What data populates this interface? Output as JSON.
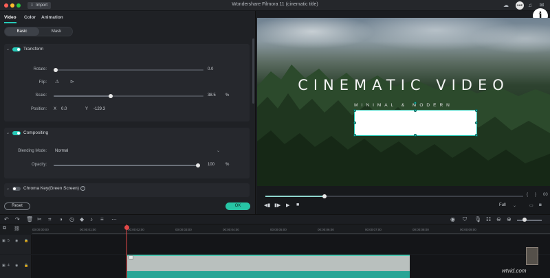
{
  "window": {
    "title": "Wondershare Filmora 11 (cinematic title)",
    "import_label": "Import",
    "avatar_text": "OUP"
  },
  "tabs": [
    {
      "label": "Video"
    },
    {
      "label": "Color"
    },
    {
      "label": "Animation"
    }
  ],
  "segments": {
    "basic": "Basic",
    "mask": "Mask"
  },
  "transform": {
    "title": "Transform",
    "rotate_label": "Rotate:",
    "rotate_value": "0.0",
    "flip_label": "Flip:",
    "scale_label": "Scale:",
    "scale_value": "38.5",
    "scale_unit": "%",
    "scale_fraction": 0.38,
    "position_label": "Position:",
    "x_label": "X",
    "x_value": "0.0",
    "y_label": "Y",
    "y_value": "-129.3"
  },
  "compositing": {
    "title": "Compositing",
    "blend_label": "Blending Mode:",
    "blend_value": "Normal",
    "opacity_label": "Opacity:",
    "opacity_value": "100",
    "opacity_unit": "%",
    "opacity_fraction": 1.0
  },
  "chroma": {
    "title": "Chroma Key(Green Screen)"
  },
  "buttons": {
    "reset": "Reset",
    "ok": "OK"
  },
  "preview": {
    "title_text": "CINEMATIC VIDEO",
    "subtitle_text": "MINIMAL & MODERN",
    "progress_fraction": 0.23,
    "quality": "Full",
    "time_prefix": "00"
  },
  "ruler": [
    "00:00:00:00",
    "00:00:01:00",
    "00:00:02:00",
    "00:00:03:00",
    "00:00:04:00",
    "00:00:05:00",
    "00:00:06:00",
    "00:00:07:00",
    "00:00:08:00",
    "00:00:09:00"
  ],
  "tracks": [
    {
      "label": "5"
    },
    {
      "label": "4"
    }
  ],
  "watermark": "wtvid.com",
  "colors": {
    "accent": "#26c9b7",
    "ok": "#27c5a5",
    "playhead": "#e04848"
  }
}
